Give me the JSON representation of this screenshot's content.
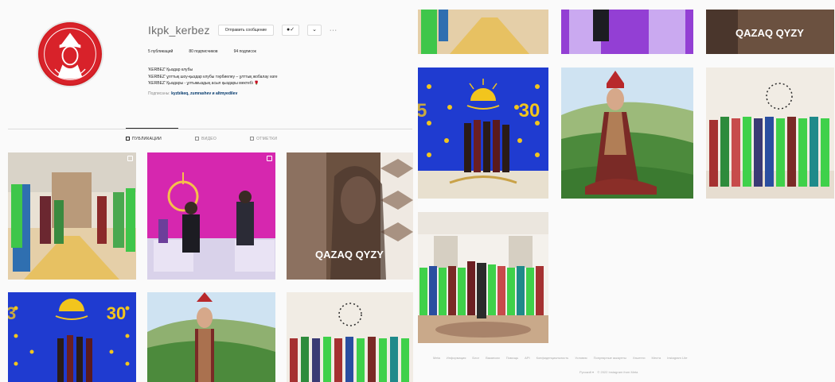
{
  "profile": {
    "username": "Ikpk_kerbez",
    "message_button": "Отправить сообщение",
    "follow_icon": "person-check-icon",
    "dropdown_icon": "chevron-down-icon",
    "more": "···",
    "avatar_icon": "red-round-logo"
  },
  "stats": {
    "posts": "5 публикаций",
    "followers": "80 подписчиков",
    "following": "94 подписок"
  },
  "bio": {
    "line1": "'KERBEZ' Қыздар клубы",
    "line2": "'KERBEZ' ұлттық шоу-қыздар клубы тәрбиелеу – ұлттық жобалау өзге",
    "line3": "'KERBEZ' Қыздары - ұлтымыздың асыл қыздары мектебі 🌹",
    "followed_by_prefix": "Подписаны:",
    "followed_by_names": "kyzbikeq, zumrashev и altmyedilev"
  },
  "tabs": [
    {
      "label": "ПУБЛИКАЦИИ",
      "active": true
    },
    {
      "label": "ВИДЕО",
      "active": false
    },
    {
      "label": "ОТМЕТКИ",
      "active": false
    }
  ],
  "overlay_text": "QAZAQ QYZY",
  "banner_number": "30",
  "footer": {
    "links": [
      "Meta",
      "Информация",
      "Блог",
      "Вакансии",
      "Помощь",
      "API",
      "Конфиденциальность",
      "Условия",
      "Популярные аккаунты",
      "Хэштеги",
      "Места",
      "Instagram Lite"
    ],
    "language": "Русский ▾",
    "copyright": "© 2022 Instagram from Meta"
  },
  "colors": {
    "brand_red": "#d8222a",
    "banner_blue": "#1f3bd0",
    "sun_yellow": "#f2c51d",
    "green_dress": "#3fd14a",
    "pink_stage": "#e02ba9"
  }
}
